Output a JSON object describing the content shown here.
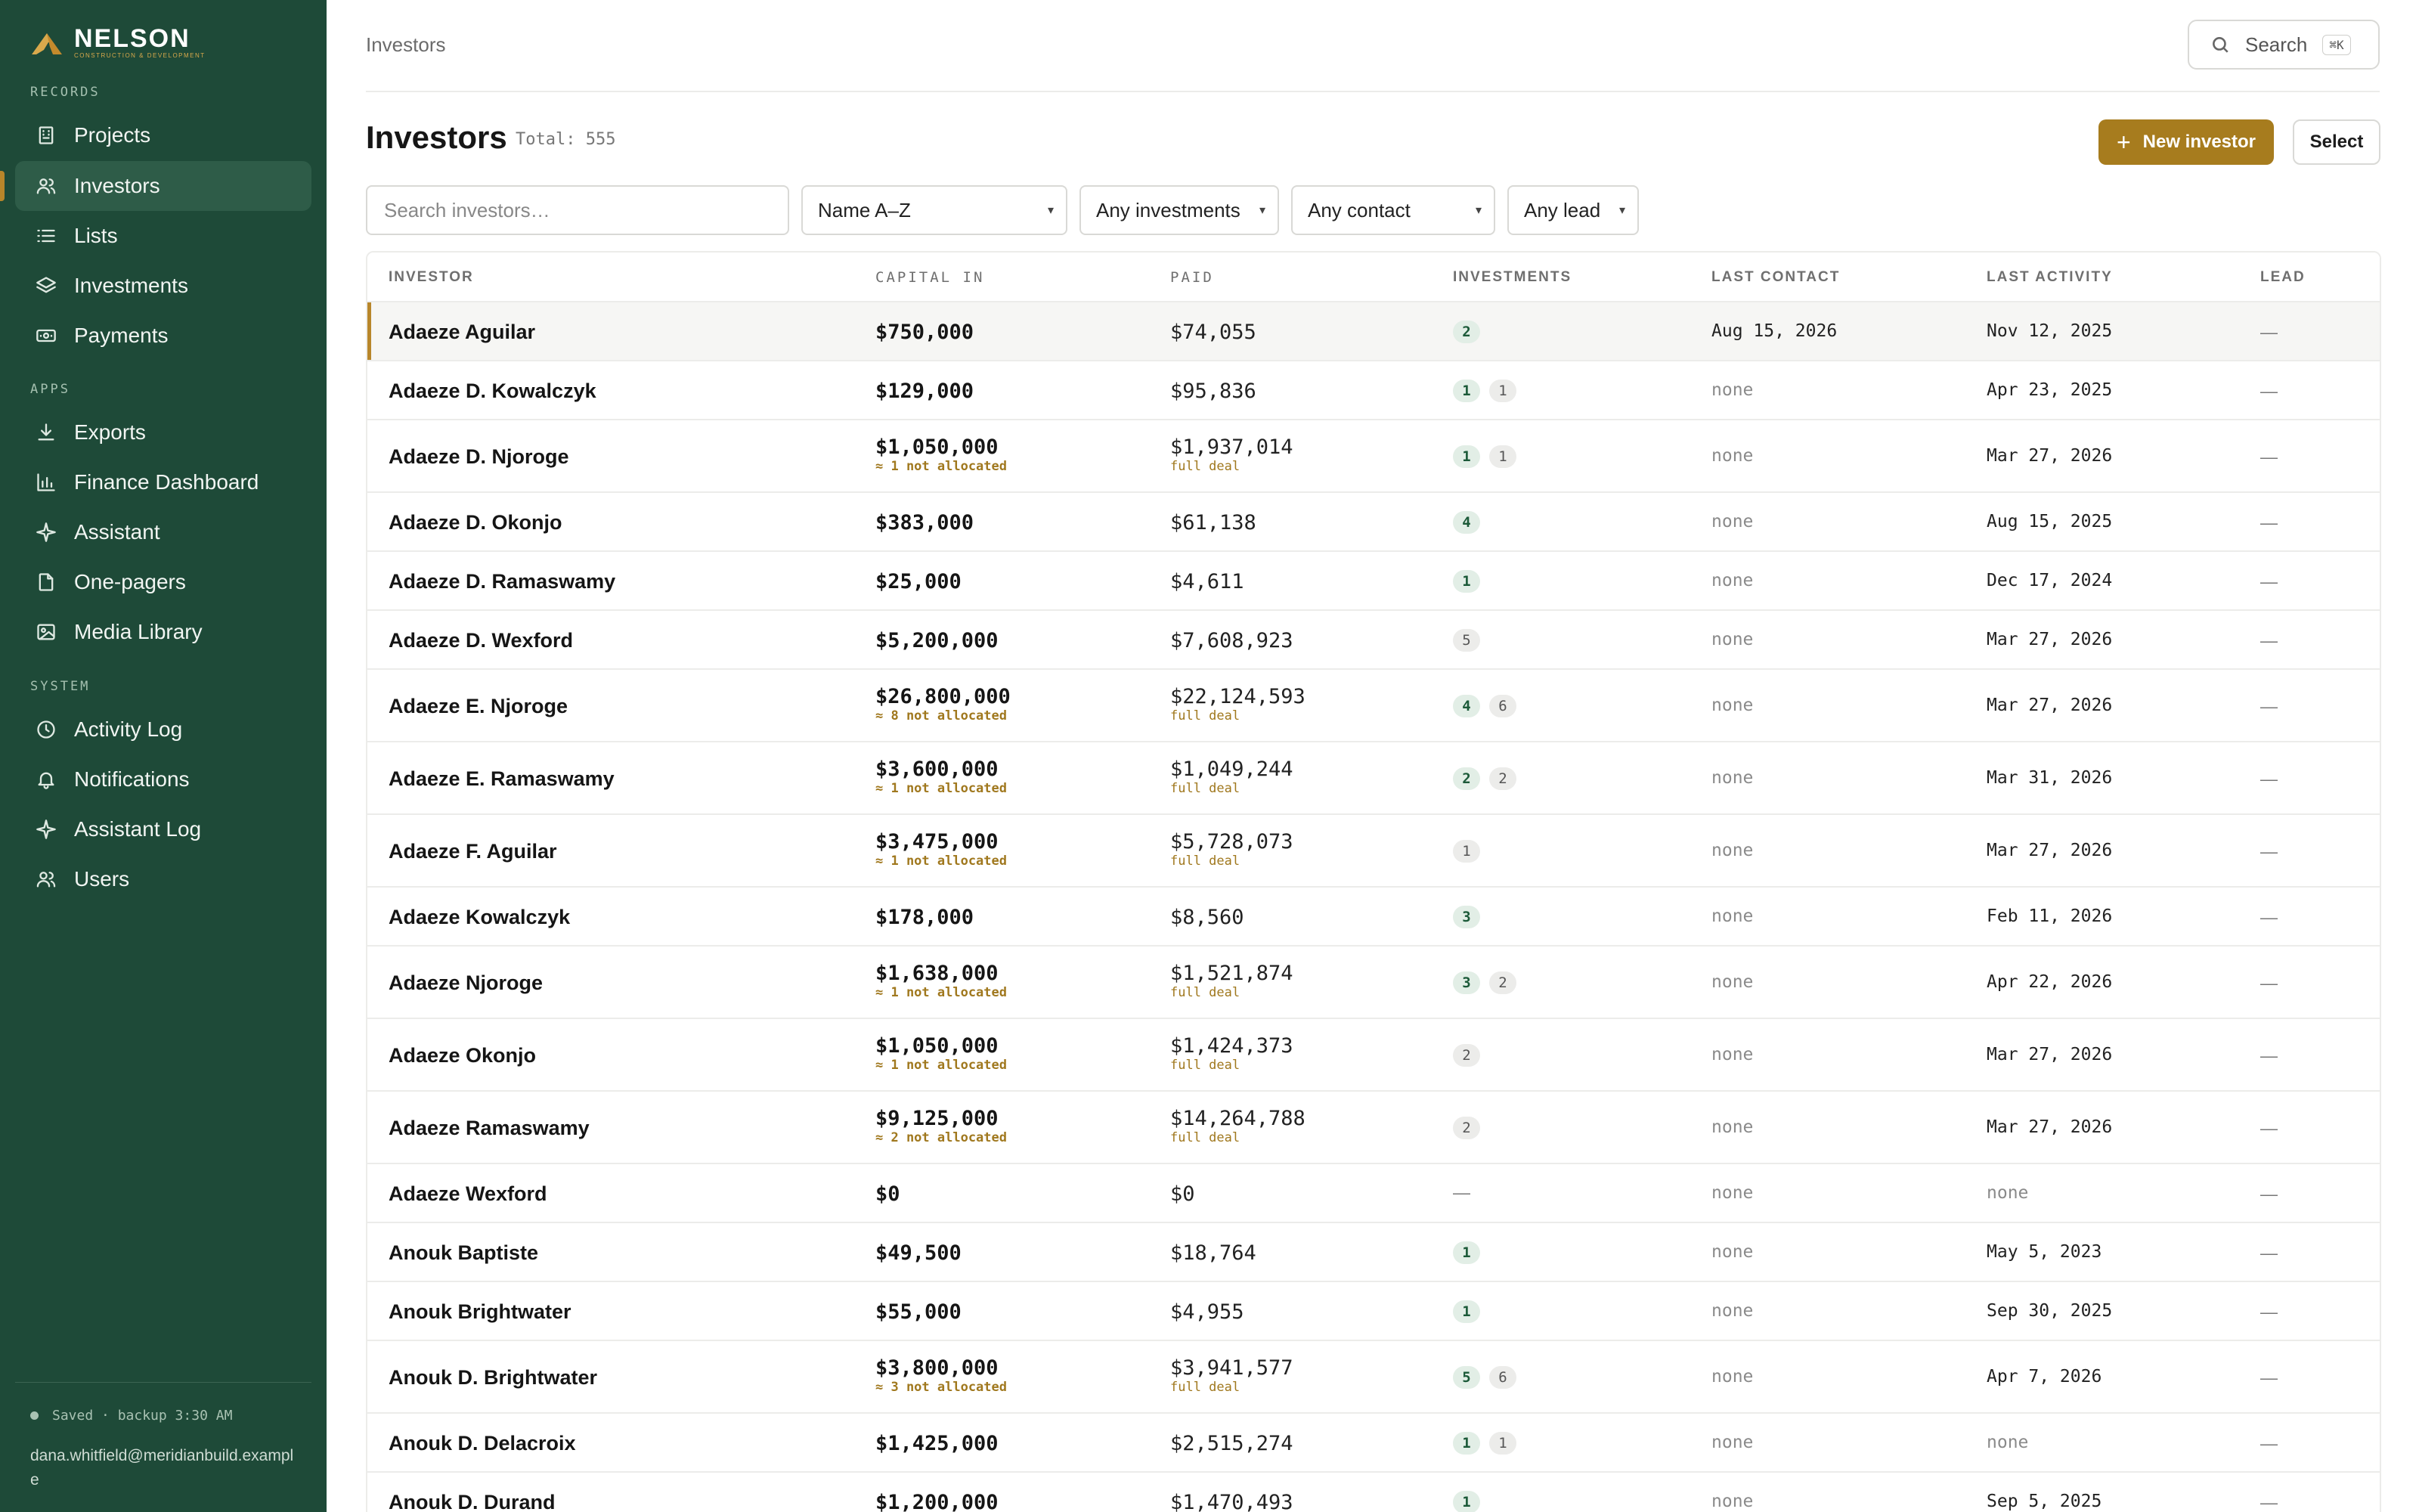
{
  "brand": {
    "name": "NELSON",
    "tagline": "CONSTRUCTION & DEVELOPMENT",
    "accent": "#b8862a",
    "sidebar_bg": "#1e4a38"
  },
  "sidebar": {
    "sections": [
      {
        "label": "RECORDS",
        "items": [
          {
            "label": "Projects",
            "icon": "building-icon"
          },
          {
            "label": "Investors",
            "icon": "users-icon",
            "active": true
          },
          {
            "label": "Lists",
            "icon": "list-icon"
          },
          {
            "label": "Investments",
            "icon": "layers-icon"
          },
          {
            "label": "Payments",
            "icon": "banknote-icon"
          }
        ]
      },
      {
        "label": "APPS",
        "items": [
          {
            "label": "Exports",
            "icon": "download-icon"
          },
          {
            "label": "Finance Dashboard",
            "icon": "bar-chart-icon"
          },
          {
            "label": "Assistant",
            "icon": "sparkle-icon"
          },
          {
            "label": "One-pagers",
            "icon": "file-icon"
          },
          {
            "label": "Media Library",
            "icon": "image-icon"
          }
        ]
      },
      {
        "label": "SYSTEM",
        "items": [
          {
            "label": "Activity Log",
            "icon": "clock-icon"
          },
          {
            "label": "Notifications",
            "icon": "bell-icon"
          },
          {
            "label": "Assistant Log",
            "icon": "sparkle-icon"
          },
          {
            "label": "Users",
            "icon": "users-icon"
          }
        ]
      }
    ],
    "saved_status": "Saved · backup 3:30 AM",
    "user_email": "dana.whitfield@meridianbuild.example"
  },
  "header": {
    "breadcrumb": "Investors",
    "search_label": "Search",
    "search_shortcut": "⌘K"
  },
  "page": {
    "title": "Investors",
    "total": "Total: 555",
    "new_button": "New investor",
    "select_button": "Select"
  },
  "filters": {
    "search_placeholder": "Search investors…",
    "sort": "Name A–Z",
    "investments": "Any investments",
    "contact": "Any contact",
    "lead": "Any lead"
  },
  "table": {
    "columns": [
      "INVESTOR",
      "CAPITAL IN",
      "PAID",
      "INVESTMENTS",
      "LAST CONTACT",
      "LAST ACTIVITY",
      "LEAD"
    ],
    "rows": [
      {
        "name": "Adaeze Aguilar",
        "capital": "$750,000",
        "capital_note": "",
        "paid": "$74,055",
        "paid_note": "",
        "investments": [
          {
            "n": "2",
            "c": "green"
          }
        ],
        "last_contact": "Aug 15, 2026",
        "last_activity": "Nov 12, 2025",
        "lead": "—",
        "selected": true
      },
      {
        "name": "Adaeze D. Kowalczyk",
        "capital": "$129,000",
        "capital_note": "",
        "paid": "$95,836",
        "paid_note": "",
        "investments": [
          {
            "n": "1",
            "c": "green"
          },
          {
            "n": "1",
            "c": "gray"
          }
        ],
        "last_contact": "none",
        "last_activity": "Apr 23, 2025",
        "lead": "—"
      },
      {
        "name": "Adaeze D. Njoroge",
        "capital": "$1,050,000",
        "capital_note": "≈ 1 not allocated",
        "paid": "$1,937,014",
        "paid_note": "full deal",
        "investments": [
          {
            "n": "1",
            "c": "green"
          },
          {
            "n": "1",
            "c": "gray"
          }
        ],
        "last_contact": "none",
        "last_activity": "Mar 27, 2026",
        "lead": "—"
      },
      {
        "name": "Adaeze D. Okonjo",
        "capital": "$383,000",
        "capital_note": "",
        "paid": "$61,138",
        "paid_note": "",
        "investments": [
          {
            "n": "4",
            "c": "green"
          }
        ],
        "last_contact": "none",
        "last_activity": "Aug 15, 2025",
        "lead": "—"
      },
      {
        "name": "Adaeze D. Ramaswamy",
        "capital": "$25,000",
        "capital_note": "",
        "paid": "$4,611",
        "paid_note": "",
        "investments": [
          {
            "n": "1",
            "c": "green"
          }
        ],
        "last_contact": "none",
        "last_activity": "Dec 17, 2024",
        "lead": "—"
      },
      {
        "name": "Adaeze D. Wexford",
        "capital": "$5,200,000",
        "capital_note": "",
        "paid": "$7,608,923",
        "paid_note": "",
        "investments": [
          {
            "n": "5",
            "c": "gray"
          }
        ],
        "last_contact": "none",
        "last_activity": "Mar 27, 2026",
        "lead": "—"
      },
      {
        "name": "Adaeze E. Njoroge",
        "capital": "$26,800,000",
        "capital_note": "≈ 8 not allocated",
        "paid": "$22,124,593",
        "paid_note": "full deal",
        "investments": [
          {
            "n": "4",
            "c": "green"
          },
          {
            "n": "6",
            "c": "gray"
          }
        ],
        "last_contact": "none",
        "last_activity": "Mar 27, 2026",
        "lead": "—"
      },
      {
        "name": "Adaeze E. Ramaswamy",
        "capital": "$3,600,000",
        "capital_note": "≈ 1 not allocated",
        "paid": "$1,049,244",
        "paid_note": "full deal",
        "investments": [
          {
            "n": "2",
            "c": "green"
          },
          {
            "n": "2",
            "c": "gray"
          }
        ],
        "last_contact": "none",
        "last_activity": "Mar 31, 2026",
        "lead": "—"
      },
      {
        "name": "Adaeze F. Aguilar",
        "capital": "$3,475,000",
        "capital_note": "≈ 1 not allocated",
        "paid": "$5,728,073",
        "paid_note": "full deal",
        "investments": [
          {
            "n": "1",
            "c": "gray"
          }
        ],
        "last_contact": "none",
        "last_activity": "Mar 27, 2026",
        "lead": "—"
      },
      {
        "name": "Adaeze Kowalczyk",
        "capital": "$178,000",
        "capital_note": "",
        "paid": "$8,560",
        "paid_note": "",
        "investments": [
          {
            "n": "3",
            "c": "green"
          }
        ],
        "last_contact": "none",
        "last_activity": "Feb 11, 2026",
        "lead": "—"
      },
      {
        "name": "Adaeze Njoroge",
        "capital": "$1,638,000",
        "capital_note": "≈ 1 not allocated",
        "paid": "$1,521,874",
        "paid_note": "full deal",
        "investments": [
          {
            "n": "3",
            "c": "green"
          },
          {
            "n": "2",
            "c": "gray"
          }
        ],
        "last_contact": "none",
        "last_activity": "Apr 22, 2026",
        "lead": "—"
      },
      {
        "name": "Adaeze Okonjo",
        "capital": "$1,050,000",
        "capital_note": "≈ 1 not allocated",
        "paid": "$1,424,373",
        "paid_note": "full deal",
        "investments": [
          {
            "n": "2",
            "c": "gray"
          }
        ],
        "last_contact": "none",
        "last_activity": "Mar 27, 2026",
        "lead": "—"
      },
      {
        "name": "Adaeze Ramaswamy",
        "capital": "$9,125,000",
        "capital_note": "≈ 2 not allocated",
        "paid": "$14,264,788",
        "paid_note": "full deal",
        "investments": [
          {
            "n": "2",
            "c": "gray"
          }
        ],
        "last_contact": "none",
        "last_activity": "Mar 27, 2026",
        "lead": "—"
      },
      {
        "name": "Adaeze Wexford",
        "capital": "$0",
        "capital_note": "",
        "paid": "$0",
        "paid_note": "",
        "investments": [],
        "investments_empty": "—",
        "last_contact": "none",
        "last_activity": "none",
        "lead": "—"
      },
      {
        "name": "Anouk Baptiste",
        "capital": "$49,500",
        "capital_note": "",
        "paid": "$18,764",
        "paid_note": "",
        "investments": [
          {
            "n": "1",
            "c": "green"
          }
        ],
        "last_contact": "none",
        "last_activity": "May 5, 2023",
        "lead": "—"
      },
      {
        "name": "Anouk Brightwater",
        "capital": "$55,000",
        "capital_note": "",
        "paid": "$4,955",
        "paid_note": "",
        "investments": [
          {
            "n": "1",
            "c": "green"
          }
        ],
        "last_contact": "none",
        "last_activity": "Sep 30, 2025",
        "lead": "—"
      },
      {
        "name": "Anouk D. Brightwater",
        "capital": "$3,800,000",
        "capital_note": "≈ 3 not allocated",
        "paid": "$3,941,577",
        "paid_note": "full deal",
        "investments": [
          {
            "n": "5",
            "c": "green"
          },
          {
            "n": "6",
            "c": "gray"
          }
        ],
        "last_contact": "none",
        "last_activity": "Apr 7, 2026",
        "lead": "—"
      },
      {
        "name": "Anouk D. Delacroix",
        "capital": "$1,425,000",
        "capital_note": "",
        "paid": "$2,515,274",
        "paid_note": "",
        "investments": [
          {
            "n": "1",
            "c": "green"
          },
          {
            "n": "1",
            "c": "gray"
          }
        ],
        "last_contact": "none",
        "last_activity": "none",
        "lead": "—"
      },
      {
        "name": "Anouk D. Durand",
        "capital": "$1,200,000",
        "capital_note": "",
        "paid": "$1,470,493",
        "paid_note": "",
        "investments": [
          {
            "n": "1",
            "c": "green"
          }
        ],
        "last_contact": "none",
        "last_activity": "Sep 5, 2025",
        "lead": "—"
      }
    ]
  }
}
